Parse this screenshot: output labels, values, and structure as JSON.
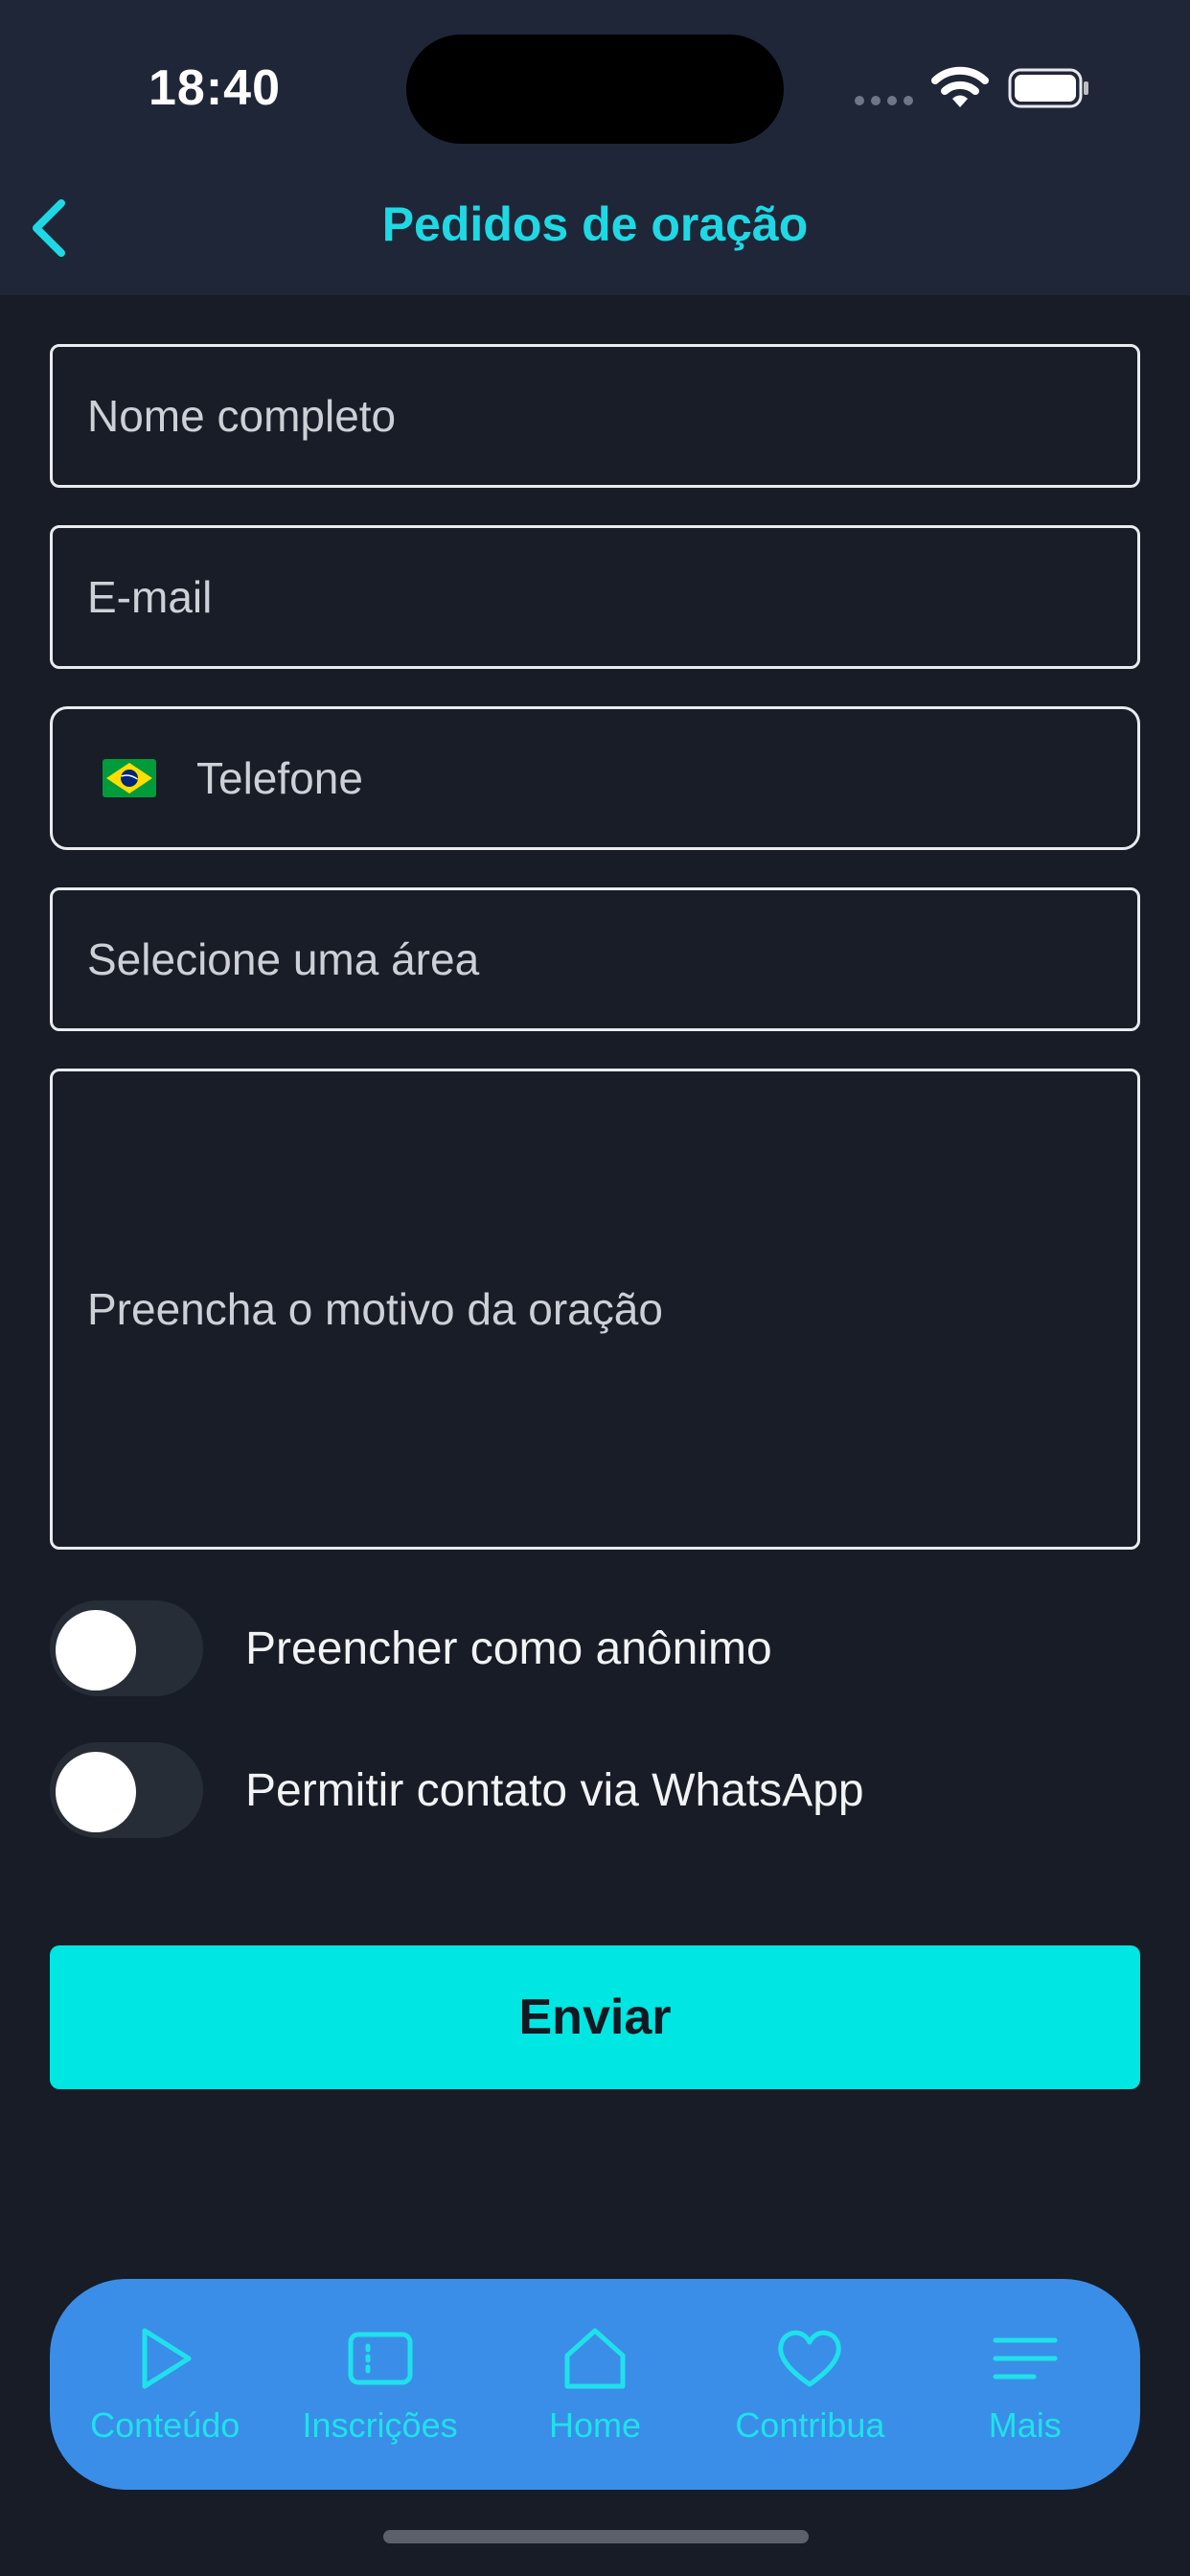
{
  "status": {
    "time": "18:40"
  },
  "nav": {
    "title": "Pedidos de oração"
  },
  "form": {
    "name_placeholder": "Nome completo",
    "email_placeholder": "E-mail",
    "phone_placeholder": "Telefone",
    "area_placeholder": "Selecione uma área",
    "reason_placeholder": "Preencha o motivo da oração",
    "anonymous_label": "Preencher como anônimo",
    "whatsapp_label": "Permitir contato via WhatsApp",
    "anonymous_on": false,
    "whatsapp_on": false,
    "submit_label": "Enviar"
  },
  "tabbar": {
    "items": [
      {
        "label": "Conteúdo",
        "icon": "play-icon"
      },
      {
        "label": "Inscrições",
        "icon": "ticket-icon"
      },
      {
        "label": "Home",
        "icon": "home-icon"
      },
      {
        "label": "Contribua",
        "icon": "heart-icon"
      },
      {
        "label": "Mais",
        "icon": "menu-icon"
      }
    ]
  },
  "colors": {
    "accent": "#1ed9e4",
    "button": "#00e6e2",
    "tabbar": "#3a8ee8",
    "background": "#171c26",
    "header": "#1f2638"
  }
}
